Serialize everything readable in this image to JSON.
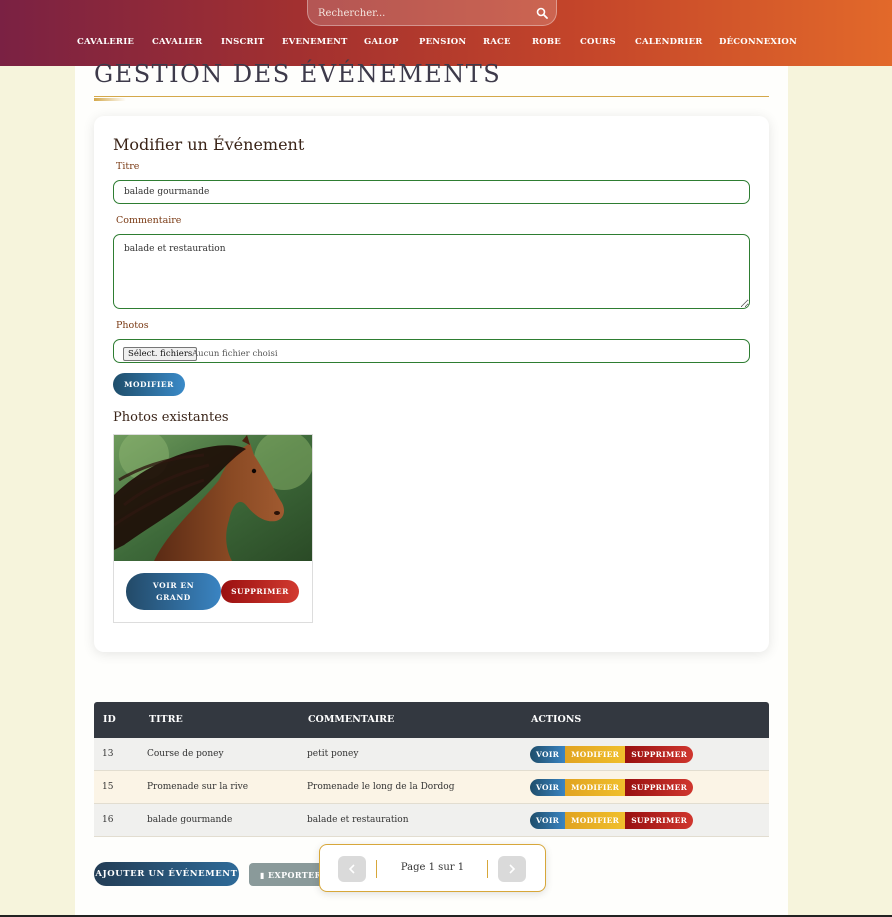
{
  "search": {
    "placeholder": "Rechercher..."
  },
  "nav": {
    "items": [
      "CAVALERIE",
      "CAVALIER",
      "INSCRIT",
      "EVENEMENT",
      "GALOP",
      "PENSION",
      "RACE",
      "ROBE",
      "COURS",
      "CALENDRIER",
      "DÉCONNEXION"
    ]
  },
  "page": {
    "title": "GESTION DES ÉVÉNEMENTS"
  },
  "form": {
    "title": "Modifier un Événement",
    "titre_label": "Titre",
    "titre_value": "balade gourmande",
    "commentaire_label": "Commentaire",
    "commentaire_value": "balade et restauration",
    "photos_label": "Photos",
    "file_button": "Sélect. fichiers",
    "file_status": "Aucun fichier choisi",
    "submit_label": "MODIFIER"
  },
  "photos": {
    "title": "Photos existantes",
    "items": [
      {
        "view_label_line1": "VOIR EN",
        "view_label_line2": "GRAND",
        "delete_label": "SUPPRIMER"
      }
    ]
  },
  "table": {
    "headers": [
      "ID",
      "TITRE",
      "COMMENTAIRE",
      "ACTIONS"
    ],
    "rows": [
      {
        "id": "13",
        "titre": "Course de poney",
        "commentaire": "petit poney"
      },
      {
        "id": "15",
        "titre": "Promenade sur la rive",
        "commentaire": "Promenade le long de la Dordog"
      },
      {
        "id": "16",
        "titre": "balade gourmande",
        "commentaire": "balade et restauration"
      }
    ],
    "action_labels": {
      "voir": "VOIR",
      "modifier": "MODIFIER",
      "supprimer": "SUPPRIMER"
    }
  },
  "footer": {
    "add_label": "AJOUTER UN ÉVÉNEMENT",
    "export_label": "EXPORTER"
  },
  "pagination": {
    "info": "Page 1 sur 1"
  },
  "colors": {
    "header_start": "#7a2143",
    "header_end": "#e2692a",
    "accent_gold": "#d4a84a",
    "field_border": "#2e7d32",
    "table_header": "#333840",
    "btn_blue": "#2e6a98",
    "btn_yellow": "#f0bf2c",
    "btn_red": "#d0362e"
  }
}
